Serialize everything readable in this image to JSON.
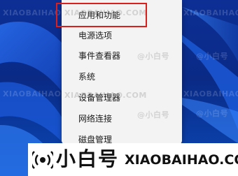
{
  "menu": {
    "items": [
      {
        "label": "应用和功能"
      },
      {
        "label": "电源选项"
      },
      {
        "label": "事件查看器"
      },
      {
        "label": "系统"
      },
      {
        "label": "设备管理器"
      },
      {
        "label": "网络连接"
      },
      {
        "label": "磁盘管理"
      }
    ],
    "highlighted_item": "应用和功能",
    "highlight_color": "#d9201c"
  },
  "watermark": {
    "text": "XIAOBAIHAO.COM",
    "brand_small": "@小白号"
  },
  "banner": {
    "brand": "小白号",
    "url": "XIAOBAIHAO.COM"
  }
}
